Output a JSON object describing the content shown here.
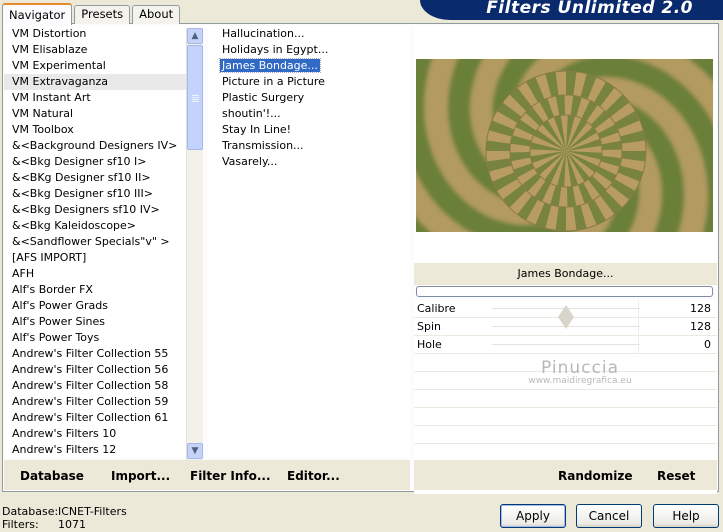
{
  "app": {
    "title": "Filters Unlimited 2.0"
  },
  "tabs": [
    {
      "label": "Navigator",
      "active": true
    },
    {
      "label": "Presets",
      "active": false
    },
    {
      "label": "About",
      "active": false
    }
  ],
  "categories": [
    "VM Distortion",
    "VM Elisablaze",
    "VM Experimental",
    "VM Extravaganza",
    "VM Instant Art",
    "VM Natural",
    "VM Toolbox",
    "&<Background Designers IV>",
    "&<Bkg Designer sf10 I>",
    "&<BKg Designer sf10 II>",
    "&<Bkg Designer sf10 III>",
    "&<Bkg Designers sf10 IV>",
    "&<Bkg Kaleidoscope>",
    "&<Sandflower Specials\"v\" >",
    "[AFS IMPORT]",
    "AFH",
    "Alf's Border FX",
    "Alf's Power Grads",
    "Alf's Power Sines",
    "Alf's Power Toys",
    "Andrew's Filter Collection 55",
    "Andrew's Filter Collection 56",
    "Andrew's Filter Collection 58",
    "Andrew's Filter Collection 59",
    "Andrew's Filter Collection 61",
    "Andrew's Filters 10",
    "Andrew's Filters 12"
  ],
  "selected_category_index": 3,
  "filters": [
    "Hallucination...",
    "Holidays in Egypt...",
    "James Bondage...",
    "Picture in a Picture",
    "Plastic Surgery",
    "shoutin'!...",
    "Stay In Line!",
    "Transmission...",
    "Vasarely..."
  ],
  "selected_filter_index": 2,
  "preview": {
    "filter_name": "James Bondage...",
    "progress": 0
  },
  "params": [
    {
      "label": "Calibre",
      "value": "128",
      "fraction": 0.5
    },
    {
      "label": "Spin",
      "value": "128",
      "fraction": 0.5
    },
    {
      "label": "Hole",
      "value": "0",
      "fraction": 0
    }
  ],
  "watermark": {
    "line1": "Pinuccia",
    "line2": "www.maidiregrafica.eu"
  },
  "toolbar_left": {
    "database": "Database",
    "import": "Import...",
    "filter_info": "Filter Info...",
    "editor": "Editor..."
  },
  "toolbar_right": {
    "randomize": "Randomize",
    "reset": "Reset"
  },
  "status": {
    "database_label": "Database:",
    "database_value": "ICNET-Filters",
    "filters_label": "Filters:",
    "filters_value": "1071"
  },
  "buttons": {
    "apply": "Apply",
    "cancel": "Cancel",
    "help": "Help"
  },
  "colors": {
    "pattern_green": "#6b7f38",
    "pattern_tan": "#b89c62",
    "selection": "#316ac5"
  }
}
